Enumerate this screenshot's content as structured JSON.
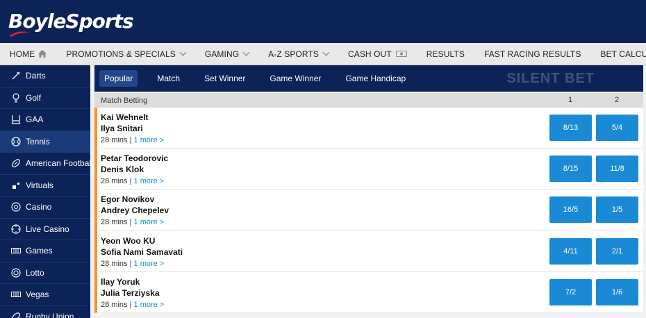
{
  "brand": {
    "logo_text": "BoyleSports"
  },
  "topnav": [
    {
      "label": "HOME",
      "icon": "home-icon"
    },
    {
      "label": "PROMOTIONS & SPECIALS",
      "icon": "chevron-down-icon"
    },
    {
      "label": "GAMING",
      "icon": "chevron-down-icon"
    },
    {
      "label": "A-Z SPORTS",
      "icon": "chevron-down-icon"
    },
    {
      "label": "CASH OUT",
      "icon": "cash-out-icon"
    },
    {
      "label": "RESULTS"
    },
    {
      "label": "FAST RACING RESULTS"
    },
    {
      "label": "BET CALCULATOR"
    }
  ],
  "sidebar": [
    {
      "label": "Darts",
      "icon": "darts-icon"
    },
    {
      "label": "Golf",
      "icon": "golf-icon"
    },
    {
      "label": "GAA",
      "icon": "gaa-icon"
    },
    {
      "label": "Tennis",
      "icon": "tennis-icon",
      "active": true
    },
    {
      "label": "American Football",
      "icon": "american-football-icon"
    },
    {
      "label": "Virtuals",
      "icon": "virtuals-icon"
    },
    {
      "label": "Casino",
      "icon": "casino-icon"
    },
    {
      "label": "Live Casino",
      "icon": "live-casino-icon"
    },
    {
      "label": "Games",
      "icon": "games-icon"
    },
    {
      "label": "Lotto",
      "icon": "lotto-icon"
    },
    {
      "label": "Vegas",
      "icon": "vegas-icon"
    },
    {
      "label": "Rugby Union",
      "icon": "rugby-union-icon"
    }
  ],
  "tabs": [
    {
      "label": "Popular",
      "active": true
    },
    {
      "label": "Match"
    },
    {
      "label": "Set Winner"
    },
    {
      "label": "Game Winner"
    },
    {
      "label": "Game Handicap"
    }
  ],
  "watermark": "SILENT BET",
  "market": {
    "title": "Match Betting",
    "col1": "1",
    "col2": "2"
  },
  "events": [
    {
      "player1": "Kai Wehnelt",
      "player2": "Ilya Snitari",
      "time": "28 mins",
      "separator": "|",
      "more": "1 more >",
      "odds1": "8/13",
      "odds2": "5/4"
    },
    {
      "player1": "Petar Teodorovic",
      "player2": "Denis Klok",
      "time": "28 mins",
      "separator": "|",
      "more": "1 more >",
      "odds1": "8/15",
      "odds2": "11/8"
    },
    {
      "player1": "Egor Novikov",
      "player2": "Andrey Chepelev",
      "time": "28 mins",
      "separator": "|",
      "more": "1 more >",
      "odds1": "16/5",
      "odds2": "1/5"
    },
    {
      "player1": "Yeon Woo KU",
      "player2": "Sofia Nami Samavati",
      "time": "28 mins",
      "separator": "|",
      "more": "1 more >",
      "odds1": "4/11",
      "odds2": "2/1"
    },
    {
      "player1": "Ilay Yoruk",
      "player2": "Julia Terziyska",
      "time": "28 mins",
      "separator": "|",
      "more": "1 more >",
      "odds1": "7/2",
      "odds2": "1/6"
    }
  ],
  "colors": {
    "navy": "#0b2357",
    "odds_blue": "#1a8ad6",
    "accent_orange": "#f5941e",
    "logo_red": "#e4202e"
  }
}
